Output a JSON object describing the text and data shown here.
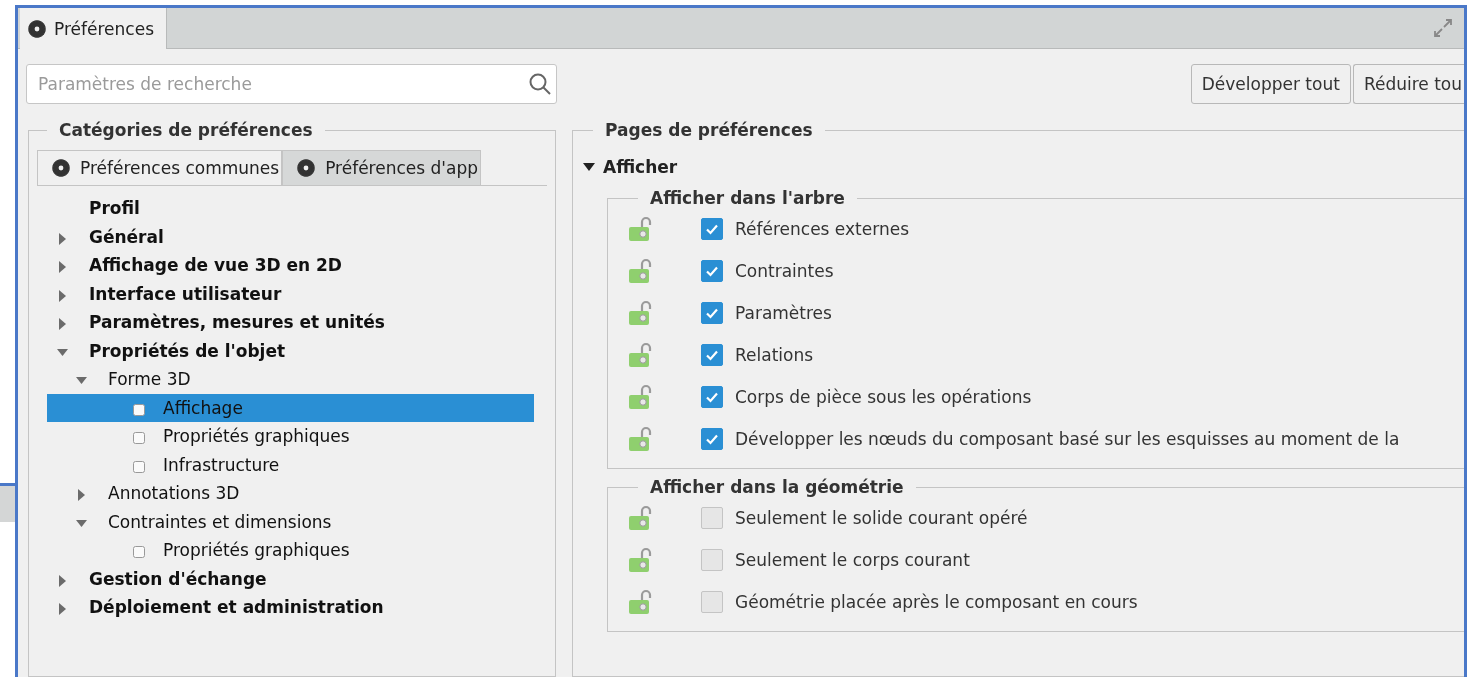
{
  "window": {
    "title": "Préférences"
  },
  "search": {
    "placeholder": "Paramètres de recherche"
  },
  "buttons": [
    "Développer tout",
    "Réduire tou"
  ],
  "categories": {
    "title": "Catégories de préférences",
    "tabs": [
      {
        "label": "Préférences communes",
        "selected": true
      },
      {
        "label": "Préférences d'app",
        "selected": false
      }
    ],
    "tree": [
      {
        "label": "Profil",
        "kind": "leaf",
        "selected": false
      },
      {
        "label": "Général",
        "kind": "category",
        "expanded": false,
        "selected": false
      },
      {
        "label": "Affichage de vue 3D en 2D",
        "kind": "category",
        "expanded": false,
        "selected": false
      },
      {
        "label": "Interface utilisateur",
        "kind": "category",
        "expanded": false,
        "selected": false
      },
      {
        "label": "Paramètres, mesures et unités",
        "kind": "category",
        "expanded": false,
        "selected": false
      },
      {
        "label": "Propriétés de l'objet",
        "kind": "category",
        "expanded": true,
        "selected": false,
        "children": [
          {
            "label": "Forme 3D",
            "kind": "category",
            "expanded": true,
            "selected": false,
            "children": [
              {
                "label": "Affichage",
                "kind": "page",
                "selected": true
              },
              {
                "label": "Propriétés graphiques",
                "kind": "page",
                "selected": false
              },
              {
                "label": "Infrastructure",
                "kind": "page",
                "selected": false
              }
            ]
          },
          {
            "label": "Annotations 3D",
            "kind": "category",
            "expanded": false,
            "selected": false
          },
          {
            "label": "Contraintes et dimensions",
            "kind": "category",
            "expanded": true,
            "selected": false,
            "children": [
              {
                "label": "Propriétés graphiques",
                "kind": "page",
                "selected": false
              }
            ]
          }
        ]
      },
      {
        "label": "Gestion d'échange",
        "kind": "category",
        "expanded": false,
        "selected": false
      },
      {
        "label": "Déploiement et administration",
        "kind": "category",
        "expanded": false,
        "selected": false
      }
    ]
  },
  "pages": {
    "title": "Pages de préférences",
    "section": {
      "label": "Afficher",
      "expanded": true,
      "groups": [
        {
          "title": "Afficher dans l'arbre",
          "options": [
            {
              "label": "Références externes",
              "checked": true
            },
            {
              "label": "Contraintes",
              "checked": true
            },
            {
              "label": "Paramètres",
              "checked": true
            },
            {
              "label": "Relations",
              "checked": true
            },
            {
              "label": "Corps de pièce sous les opérations",
              "checked": true
            },
            {
              "label": "Développer les nœuds du composant basé sur les esquisses au moment de la",
              "checked": true
            }
          ]
        },
        {
          "title": "Afficher dans la géométrie",
          "options": [
            {
              "label": "Seulement le solide courant opéré",
              "checked": false
            },
            {
              "label": "Seulement le corps courant",
              "checked": false
            },
            {
              "label": "Géométrie placée après le composant en cours",
              "checked": false
            }
          ]
        }
      ]
    }
  }
}
